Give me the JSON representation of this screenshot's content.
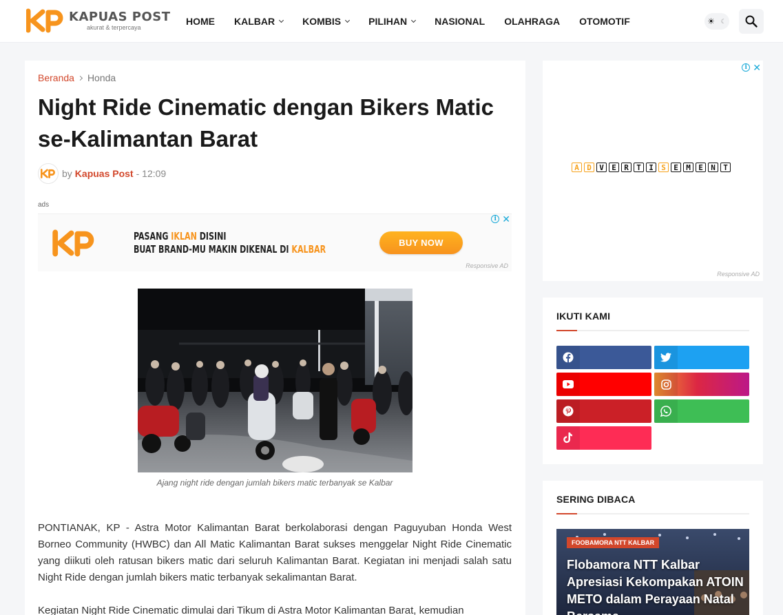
{
  "site": {
    "logo_letters": "KP",
    "name": "KAPUAS POST",
    "tagline": "akurat & terpercaya"
  },
  "nav": [
    {
      "label": "HOME",
      "dropdown": false
    },
    {
      "label": "KALBAR",
      "dropdown": true
    },
    {
      "label": "KOMBIS",
      "dropdown": true
    },
    {
      "label": "PILIHAN",
      "dropdown": true
    },
    {
      "label": "NASIONAL",
      "dropdown": false
    },
    {
      "label": "OLAHRAGA",
      "dropdown": false
    },
    {
      "label": "OTOMOTIF",
      "dropdown": false
    }
  ],
  "breadcrumb": {
    "home": "Beranda",
    "current": "Honda"
  },
  "article": {
    "title": "Night Ride Cinematic dengan Bikers Matic se-Kalimantan Barat",
    "by": "by",
    "author": "Kapuas Post",
    "time": "- 12:09",
    "ads_label": "ads",
    "caption": "Ajang night ride dengan jumlah bikers matic terbanyak se Kalbar",
    "paragraph1": "PONTIANAK, KP - Astra Motor Kalimantan Barat berkolaborasi dengan Paguyuban Honda West Borneo Community (HWBC) dan All Matic Kalimantan Barat sukses menggelar Night Ride Cinematic yang diikuti oleh ratusan bikers matic dari seluruh Kalimantan Barat. Kegiatan ini menjadi salah satu Night Ride dengan jumlah bikers matic terbanyak sekalimantan Barat.",
    "paragraph2": "Kegiatan Night Ride Cinematic dimulai dari Tikum di Astra Motor Kalimantan Barat, kemudian"
  },
  "ad_banner": {
    "line1_a": "PASANG ",
    "line1_hl": "IKLAN",
    "line1_b": " DISINI",
    "line2_a": "BUAT BRAND-MU MAKIN DIKENAL DI ",
    "line2_hl": "KALBAR",
    "cta": "BUY NOW",
    "responsive": "Responsive AD"
  },
  "sidebar_ad": {
    "word": [
      "A",
      "D",
      "V",
      "E",
      "R",
      "T",
      "I",
      "S",
      "E",
      "M",
      "E",
      "N",
      "T"
    ],
    "responsive": "Responsive AD"
  },
  "follow": {
    "title": "IKUTI KAMI",
    "networks": [
      {
        "name": "facebook",
        "color": "#3b5998"
      },
      {
        "name": "twitter",
        "color": "#1da1f2"
      },
      {
        "name": "youtube",
        "color": "#ff0000"
      },
      {
        "name": "instagram",
        "color": "#c13584"
      },
      {
        "name": "pinterest",
        "color": "#cb2027"
      },
      {
        "name": "whatsapp",
        "color": "#3ebe55"
      },
      {
        "name": "tiktok",
        "color": "#fe2c55"
      }
    ]
  },
  "popular": {
    "title": "SERING DIBACA",
    "tag": "FOOBAMORA NTT KALBAR",
    "headline": "Flobamora NTT Kalbar Apresiasi Kekompakan ATOIN METO dalam Perayaan Natal Bersama"
  },
  "colors": {
    "accent": "#d2472b",
    "logo_orange": "#f7941d",
    "info_blue": "#19a9d8"
  }
}
